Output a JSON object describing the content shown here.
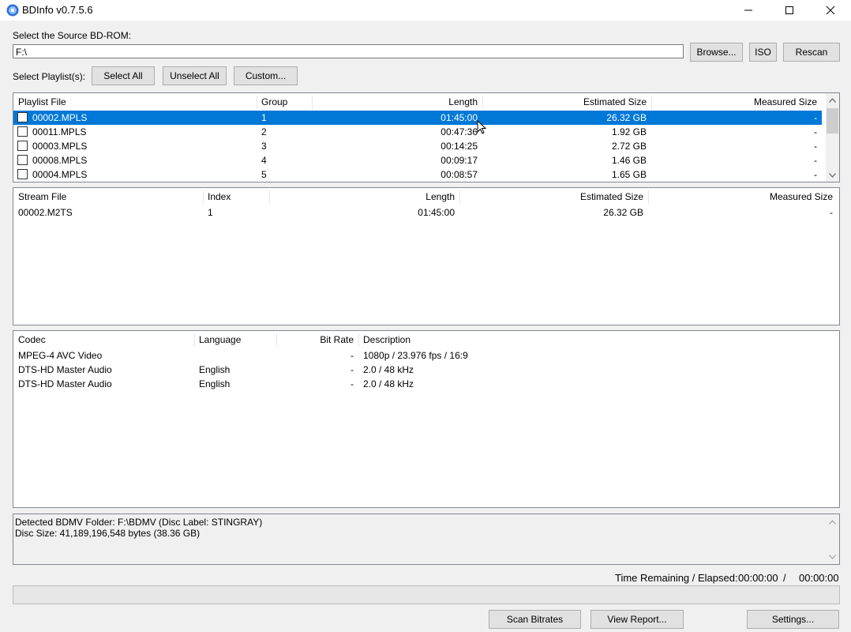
{
  "window": {
    "title": "BDInfo v0.7.5.6",
    "controls": {
      "minimize": "—",
      "maximize": "☐",
      "close": "✕"
    }
  },
  "source": {
    "label": "Select the Source BD-ROM:",
    "path": "F:\\",
    "browse": "Browse...",
    "iso": "ISO",
    "rescan": "Rescan"
  },
  "playlist_controls": {
    "label": "Select Playlist(s):",
    "select_all": "Select All",
    "unselect_all": "Unselect All",
    "custom": "Custom..."
  },
  "playlists": {
    "headers": [
      "Playlist File",
      "Group",
      "Length",
      "Estimated Size",
      "Measured Size"
    ],
    "rows": [
      {
        "file": "00002.MPLS",
        "group": "1",
        "length": "01:45:00",
        "est": "26.32 GB",
        "meas": "-",
        "selected": true
      },
      {
        "file": "00011.MPLS",
        "group": "2",
        "length": "00:47:36",
        "est": "1.92 GB",
        "meas": "-",
        "selected": false
      },
      {
        "file": "00003.MPLS",
        "group": "3",
        "length": "00:14:25",
        "est": "2.72 GB",
        "meas": "-",
        "selected": false
      },
      {
        "file": "00008.MPLS",
        "group": "4",
        "length": "00:09:17",
        "est": "1.46 GB",
        "meas": "-",
        "selected": false
      },
      {
        "file": "00004.MPLS",
        "group": "5",
        "length": "00:08:57",
        "est": "1.65 GB",
        "meas": "-",
        "selected": false
      }
    ]
  },
  "streams": {
    "headers": [
      "Stream File",
      "Index",
      "Length",
      "Estimated Size",
      "Measured Size"
    ],
    "rows": [
      {
        "file": "00002.M2TS",
        "index": "1",
        "length": "01:45:00",
        "est": "26.32 GB",
        "meas": "-"
      }
    ]
  },
  "codecs": {
    "headers": [
      "Codec",
      "Language",
      "Bit Rate",
      "Description"
    ],
    "rows": [
      {
        "codec": "MPEG-4 AVC Video",
        "language": "",
        "bitrate": "-",
        "desc": "1080p / 23.976 fps / 16:9"
      },
      {
        "codec": "DTS-HD Master Audio",
        "language": "English",
        "bitrate": "-",
        "desc": "2.0 / 48 kHz"
      },
      {
        "codec": "DTS-HD Master Audio",
        "language": "English",
        "bitrate": "-",
        "desc": "2.0 / 48 kHz"
      }
    ]
  },
  "info": {
    "line1": "Detected BDMV Folder: F:\\BDMV (Disc Label: STINGRAY)",
    "line2": "Disc Size: 41,189,196,548 bytes (38.36 GB)"
  },
  "status": {
    "label": "Time Remaining / Elapsed:",
    "remaining": "00:00:00",
    "separator": "/",
    "elapsed": "00:00:00",
    "progress": 0
  },
  "bottom_buttons": {
    "scan": "Scan Bitrates",
    "report": "View Report...",
    "settings": "Settings..."
  },
  "colors": {
    "selection": "#0078d7",
    "window_bg": "#f0f0f0"
  }
}
